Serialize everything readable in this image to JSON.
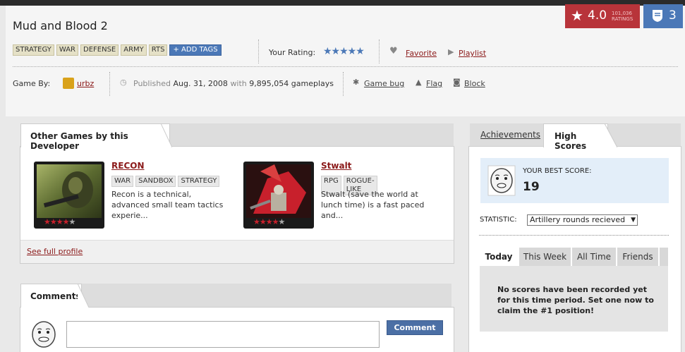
{
  "game": {
    "title": "Mud and Blood 2",
    "rating": "4.0",
    "rating_count": "101,036",
    "rating_count_label": "RATINGS",
    "level": "3",
    "tags": [
      "STRATEGY",
      "WAR",
      "DEFENSE",
      "ARMY",
      "RTS"
    ],
    "add_tags_label": "+ ADD TAGS",
    "your_rating_label": "Your Rating:",
    "your_rating_stars": "★★★★★",
    "favorite_label": "Favorite",
    "playlist_label": "Playlist",
    "game_by_label": "Game By:",
    "developer": "urbz",
    "published_prefix": "Published",
    "published_date": "Aug. 31, 2008",
    "published_with": "with",
    "gameplays": "9,895,054 gameplays",
    "game_bug_label": "Game bug",
    "flag_label": "Flag",
    "block_label": "Block"
  },
  "other_games": {
    "tab_label": "Other Games by this Developer",
    "games": [
      {
        "title": "RECON",
        "tags": [
          "WAR",
          "SANDBOX",
          "STRATEGY"
        ],
        "description": "Recon is a technical, advanced small team tactics experie...",
        "rating": 4,
        "stars_on": "★★★★",
        "stars_off": "★"
      },
      {
        "title": "Stwalt",
        "tags": [
          "RPG",
          "ROGUE-LIKE"
        ],
        "description": "Stwalt (save the world at lunch time) is a fast paced and...",
        "rating": 4,
        "stars_on": "★★★★",
        "stars_off": "★"
      }
    ],
    "see_profile_label": "See full profile"
  },
  "comments": {
    "tab_label": "Comments",
    "input_value": "",
    "button_label": "Comment"
  },
  "high_scores": {
    "achievements_tab": "Achievements",
    "high_scores_tab": "High Scores",
    "best_score_label": "YOUR BEST SCORE:",
    "best_score": "19",
    "statistic_label": "STATISTIC:",
    "statistic_selected": "Artillery rounds recieved",
    "period_tabs": [
      "Today",
      "This Week",
      "All Time",
      "Friends"
    ],
    "active_period": "Today",
    "empty_message": "No scores have been recorded yet for this time period. Set one now to claim the #1 position!"
  },
  "colors": {
    "rating_red": "#b8343a",
    "level_blue": "#4b78b7",
    "link_maroon": "#8b1a1a"
  },
  "icons": [
    "star-icon",
    "shield-icon",
    "heart-icon",
    "play-icon",
    "clock-icon",
    "bug-icon",
    "flag-icon",
    "block-icon",
    "rage-face-icon"
  ]
}
